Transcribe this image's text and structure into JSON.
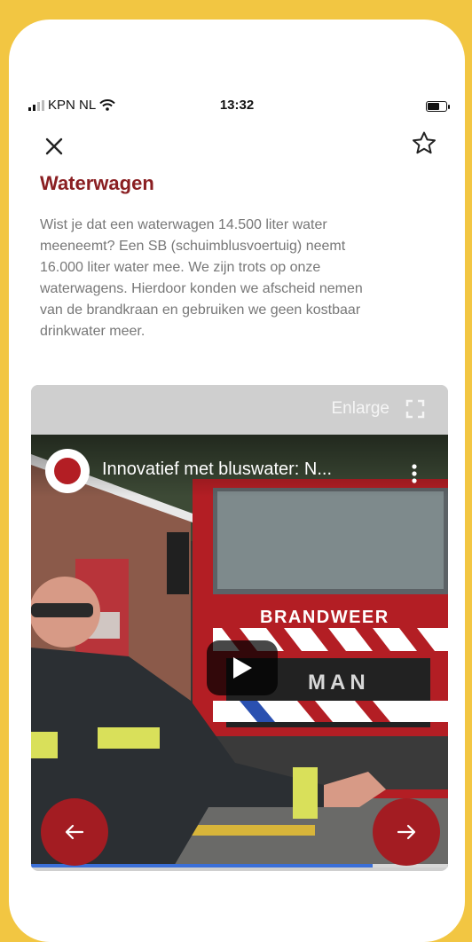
{
  "status_bar": {
    "carrier": "KPN NL",
    "time": "13:32"
  },
  "header": {
    "title": "Waterwagen"
  },
  "content": {
    "lines": [
      "Wist je dat een waterwagen 14.500 liter water",
      "meeneemt? Een SB (schuimblusvoertuig) neemt",
      "16.000 liter water mee. We zijn trots op onze",
      "waterwagens. Hierdoor konden we afscheid nemen",
      "van de brandkraan en gebruiken we geen kostbaar",
      "drinkwater meer."
    ]
  },
  "media": {
    "enlarge_label": "Enlarge",
    "video_title": "Innovatief met bluswater: N...",
    "truck_sign": "BRANDWEER",
    "truck_brand": "MAN",
    "progress": 0.82
  },
  "colors": {
    "background": "#f2c642",
    "accent": "#a31c22",
    "title": "#8a1f22",
    "progress": "#3b6fd8"
  },
  "icons": {
    "close": "close-icon",
    "favorite": "star-outline-icon",
    "expand": "expand-icon",
    "prev": "arrow-left-icon",
    "next": "arrow-right-icon",
    "play": "play-icon",
    "more": "more-vertical-icon"
  }
}
